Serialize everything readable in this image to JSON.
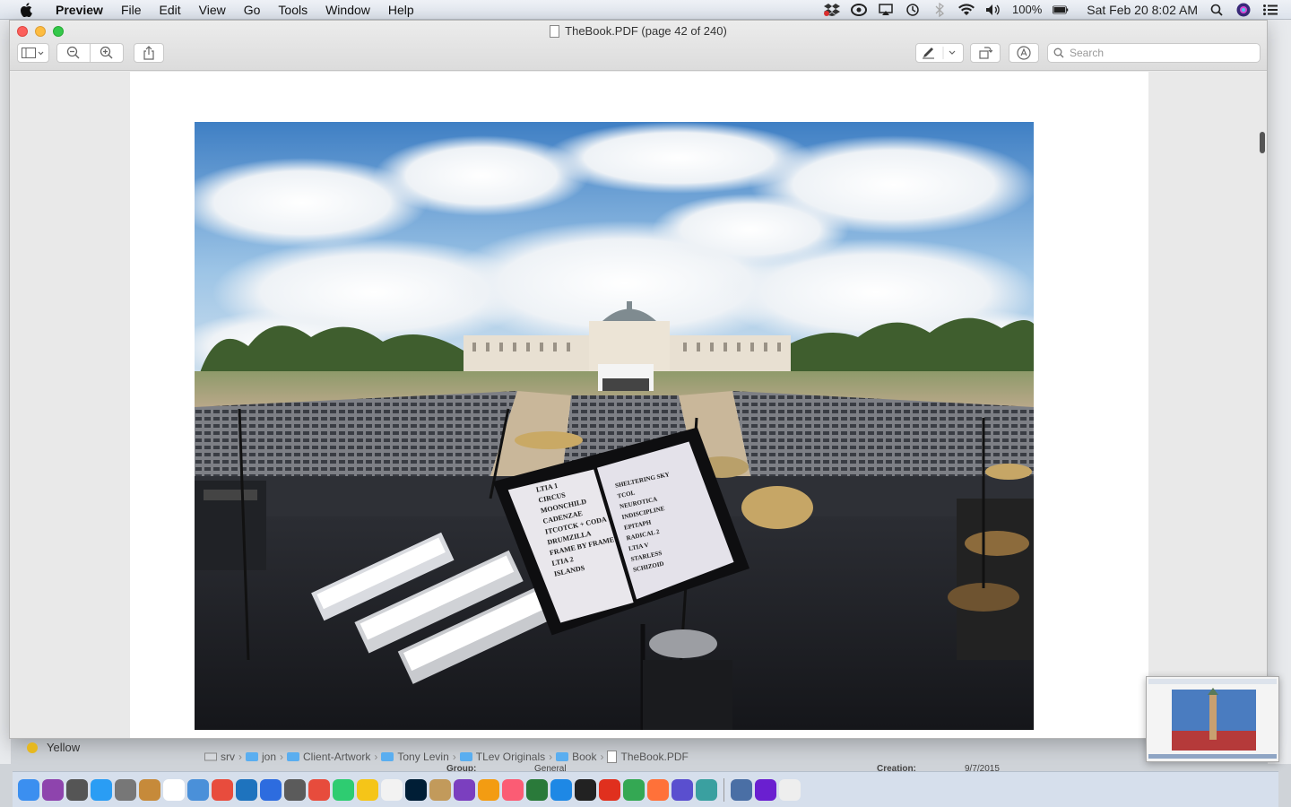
{
  "menubar": {
    "app_name": "Preview",
    "items": [
      "File",
      "Edit",
      "View",
      "Go",
      "Tools",
      "Window",
      "Help"
    ],
    "battery": "100%",
    "datetime": "Sat Feb 20  8:02 AM"
  },
  "window": {
    "title": "TheBook.PDF (page 42 of 240)",
    "search_placeholder": "Search"
  },
  "finder_behind": {
    "tag_label": "Yellow",
    "tag_color": "#e6b820",
    "path": [
      "srv",
      "jon",
      "Client-Artwork",
      "Tony Levin",
      "TLev Originals",
      "Book",
      "TheBook.PDF"
    ],
    "group_label": "Group:",
    "group_value": "General",
    "creation_label": "Creation:",
    "creation_value": "9/7/2015"
  },
  "setlist": {
    "left": [
      "LTIA 1",
      "CIRCUS",
      "MOONCHILD",
      "CADENZAE",
      "ITCOTCK + CODA",
      "DRUMZILLA",
      "FRAME BY FRAME",
      "LTIA 2",
      "ISLANDS"
    ],
    "right": [
      "SHELTERING SKY",
      "TCOL",
      "NEUROTICA",
      "INDISCIPLINE",
      "EPITAPH",
      "RADICAL 2",
      "LTIA V",
      "STARLESS",
      "SCHIZOID"
    ]
  },
  "dock_colors": [
    "#3b8ff0",
    "#8e44ad",
    "#555555",
    "#2a9df4",
    "#777777",
    "#c68a3a",
    "#ffffff",
    "#4a90d9",
    "#e84c3d",
    "#1e73be",
    "#2d6cdf",
    "#5b5b5b",
    "#e74c3c",
    "#2ecc71",
    "#f5c518",
    "#f2f2f2",
    "#001e36",
    "#c29a5b",
    "#7b3fbf",
    "#f39c12",
    "#fb5c74",
    "#2a7a3a",
    "#1e88e5",
    "#222222",
    "#e0301e",
    "#34a853",
    "#ff7139",
    "#5a4fcf",
    "#3aa0a0",
    "#4a6fa5",
    "#6a1fd0",
    "#eeeeee"
  ]
}
